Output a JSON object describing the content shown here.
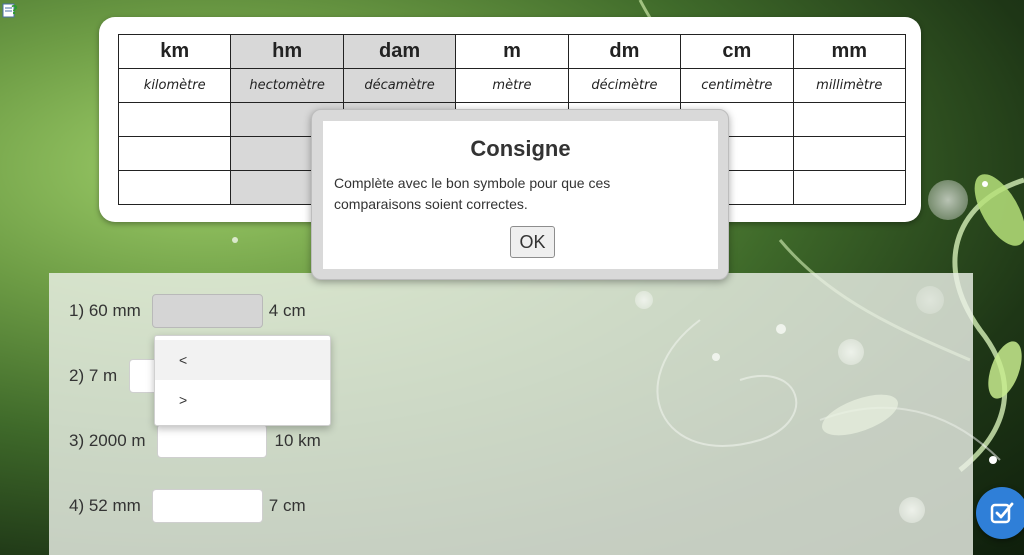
{
  "colors": {
    "accent": "#2f7fd8",
    "shade": "#d8d8d8",
    "panel": "#ebf0e8"
  },
  "icons": {
    "help": "help-question-icon",
    "check": "check-square-icon"
  },
  "units_table": {
    "symbols": [
      "km",
      "hm",
      "dam",
      "m",
      "dm",
      "cm",
      "mm"
    ],
    "names": [
      "kilomètre",
      "hectomètre",
      "décamètre",
      "mètre",
      "décimètre",
      "centimètre",
      "millimètre"
    ]
  },
  "questions": [
    {
      "left": "1) 60 mm",
      "value": "",
      "right": "4 cm"
    },
    {
      "left": "2) 7 m",
      "value": "",
      "right": ""
    },
    {
      "left": "3) 2000 m",
      "value": "",
      "right": "10 km"
    },
    {
      "left": "4) 52 mm",
      "value": "",
      "right": "7 cm"
    }
  ],
  "dropdown": {
    "options": [
      "<",
      ">"
    ]
  },
  "modal": {
    "title": "Consigne",
    "text": "Complète avec le bon symbole pour que ces comparaisons soient correctes.",
    "ok_label": "OK"
  }
}
